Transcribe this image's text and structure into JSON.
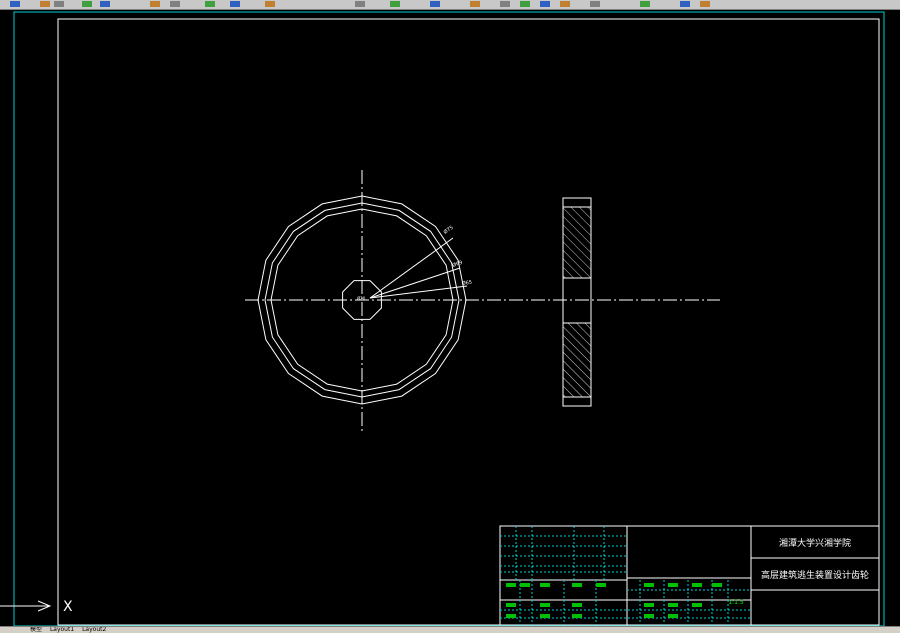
{
  "toolbar": {
    "icons": [
      "toolbar-divider",
      "open-icon",
      "save-icon",
      "plot-icon",
      "cut-icon",
      "copy-icon",
      "paste-icon",
      "undo-icon",
      "zoom-icon",
      "pan-icon",
      "properties-icon",
      "layer-icon"
    ]
  },
  "drawing": {
    "dims": {
      "d1": "Ø75",
      "d2": "Ø69",
      "d3": "Ø65",
      "hub": "Ø20"
    }
  },
  "title_block": {
    "school": "湘潭大学兴湘学院",
    "title": "高层建筑逃生装置设计齿轮",
    "ratio": "1:1.5"
  },
  "ucs": {
    "x_label": "X"
  },
  "statusbar": {
    "tabs": [
      "模型",
      "Layout1",
      "Layout2"
    ]
  },
  "colors": {
    "background": "#000000",
    "geometry": "#ffffff",
    "frame": "#00e0e0",
    "text_green": "#00ff00"
  }
}
